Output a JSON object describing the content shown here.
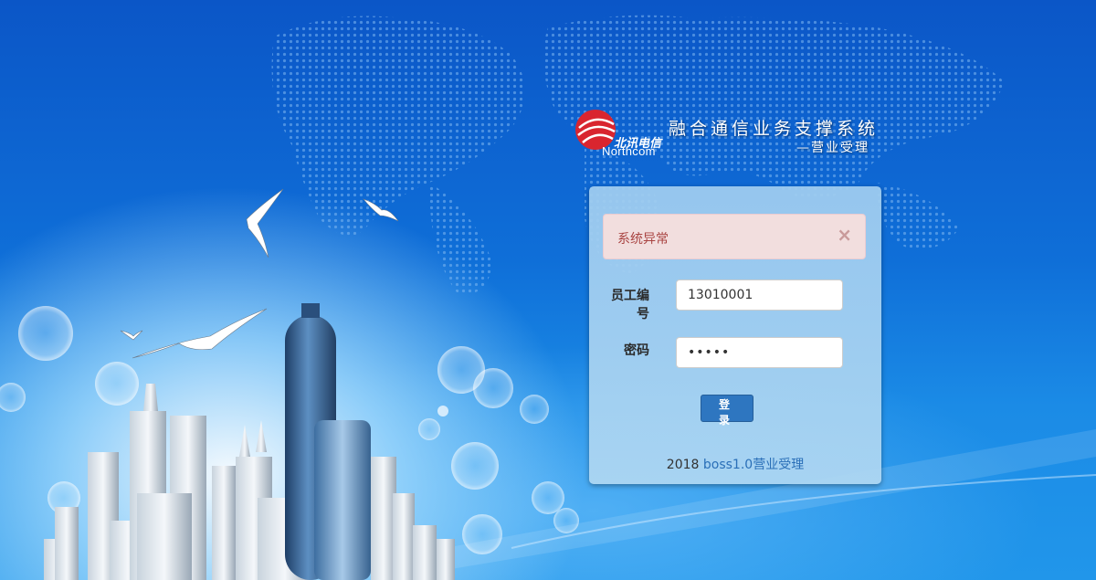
{
  "brand": {
    "logo_cn": "北讯电信",
    "logo_en": "Northcom",
    "title": "融合通信业务支撑系统",
    "subtitle": "—营业受理",
    "accent_color": "#d9252f"
  },
  "alert": {
    "message": "系统异常",
    "close_icon": "×"
  },
  "form": {
    "employee_label": "员工编号",
    "employee_value": "13010001",
    "password_label": "密码",
    "password_value": "•••••",
    "login_button": "登 录"
  },
  "footer": {
    "year": "2018",
    "link_text": "boss1.0营业受理"
  },
  "icons": {
    "logo": "northcom-logo-icon",
    "close": "close-icon"
  }
}
